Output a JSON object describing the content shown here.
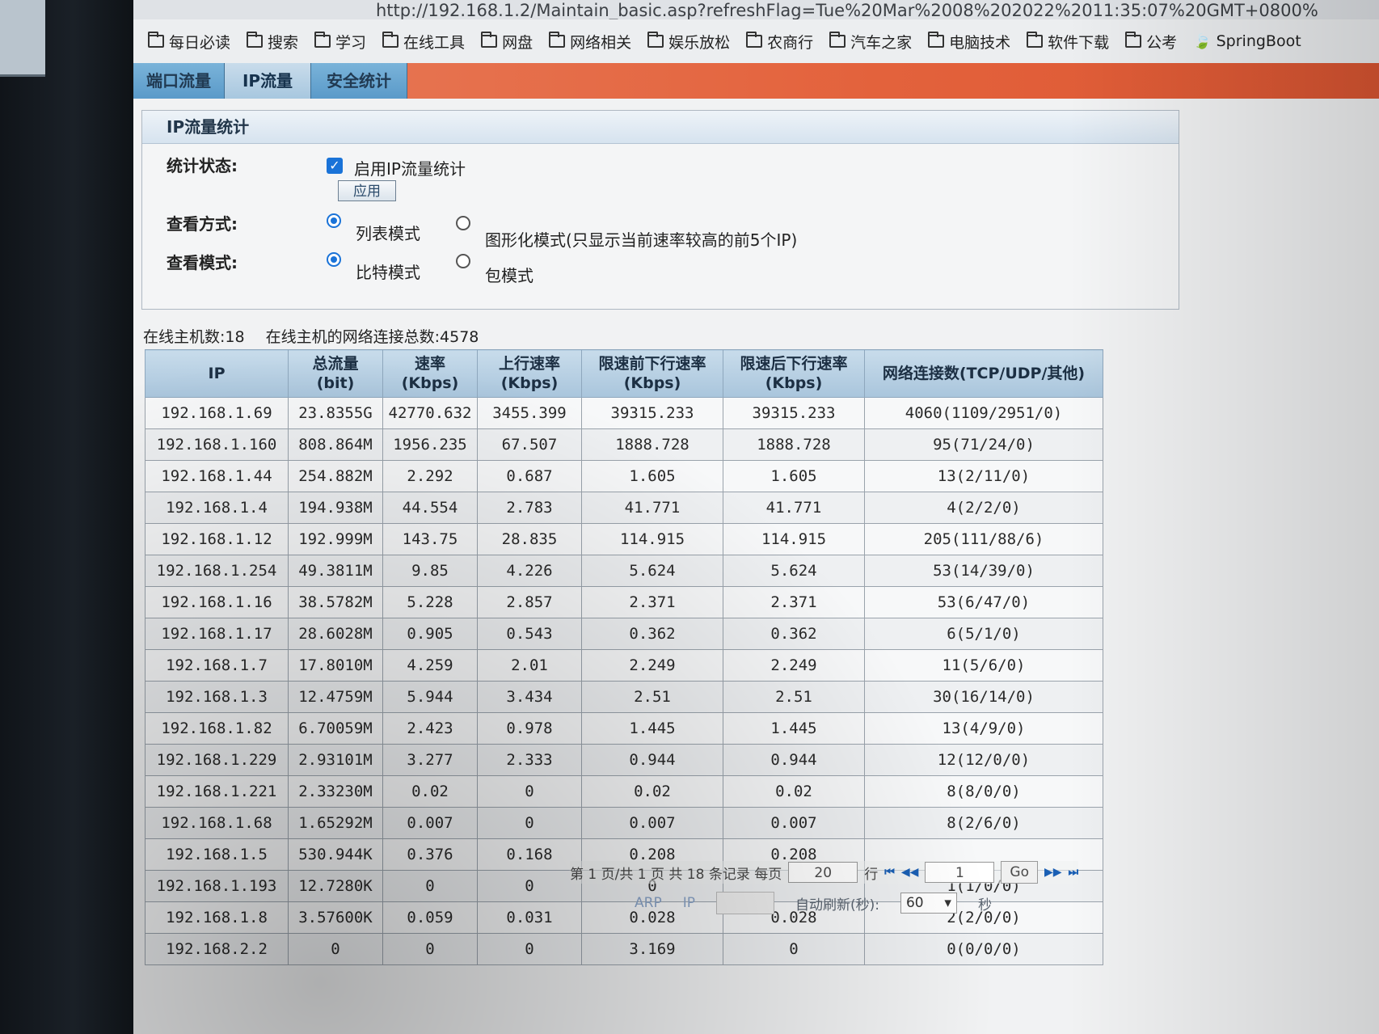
{
  "browser": {
    "url": "http://192.168.1.2/Maintain_basic.asp?refreshFlag=Tue%20Mar%2008%202022%2011:35:07%20GMT+0800%",
    "bookmarks": [
      "每日必读",
      "搜索",
      "学习",
      "在线工具",
      "网盘",
      "网络相关",
      "娱乐放松",
      "农商行",
      "汽车之家",
      "电脑技术",
      "软件下载",
      "公考",
      "SpringBoot"
    ]
  },
  "tabs": [
    {
      "label": "端口流量",
      "active": false
    },
    {
      "label": "IP流量",
      "active": true
    },
    {
      "label": "安全统计",
      "active": false
    }
  ],
  "panel": {
    "title": "IP流量统计",
    "status_label": "统计状态:",
    "enable_label": "启用IP流量统计",
    "enable_checked": true,
    "apply_label": "应用",
    "view_method_label": "查看方式:",
    "view_method_options": [
      "列表模式",
      "图形化模式(只显示当前速率较高的前5个IP)"
    ],
    "view_method_selected": 0,
    "view_mode_label": "查看模式:",
    "view_mode_options": [
      "比特模式",
      "包模式"
    ],
    "view_mode_selected": 0
  },
  "summary": {
    "online_hosts": "在线主机数:18",
    "online_connections": "在线主机的网络连接总数:4578"
  },
  "table": {
    "headers": [
      "IP",
      "总流量\n(bit)",
      "速率\n(Kbps)",
      "上行速率\n(Kbps)",
      "限速前下行速率\n(Kbps)",
      "限速后下行速率\n(Kbps)",
      "网络连接数(TCP/UDP/其他)"
    ],
    "rows": [
      [
        "192.168.1.69",
        "23.8355G",
        "42770.632",
        "3455.399",
        "39315.233",
        "39315.233",
        "4060(1109/2951/0)"
      ],
      [
        "192.168.1.160",
        "808.864M",
        "1956.235",
        "67.507",
        "1888.728",
        "1888.728",
        "95(71/24/0)"
      ],
      [
        "192.168.1.44",
        "254.882M",
        "2.292",
        "0.687",
        "1.605",
        "1.605",
        "13(2/11/0)"
      ],
      [
        "192.168.1.4",
        "194.938M",
        "44.554",
        "2.783",
        "41.771",
        "41.771",
        "4(2/2/0)"
      ],
      [
        "192.168.1.12",
        "192.999M",
        "143.75",
        "28.835",
        "114.915",
        "114.915",
        "205(111/88/6)"
      ],
      [
        "192.168.1.254",
        "49.3811M",
        "9.85",
        "4.226",
        "5.624",
        "5.624",
        "53(14/39/0)"
      ],
      [
        "192.168.1.16",
        "38.5782M",
        "5.228",
        "2.857",
        "2.371",
        "2.371",
        "53(6/47/0)"
      ],
      [
        "192.168.1.17",
        "28.6028M",
        "0.905",
        "0.543",
        "0.362",
        "0.362",
        "6(5/1/0)"
      ],
      [
        "192.168.1.7",
        "17.8010M",
        "4.259",
        "2.01",
        "2.249",
        "2.249",
        "11(5/6/0)"
      ],
      [
        "192.168.1.3",
        "12.4759M",
        "5.944",
        "3.434",
        "2.51",
        "2.51",
        "30(16/14/0)"
      ],
      [
        "192.168.1.82",
        "6.70059M",
        "2.423",
        "0.978",
        "1.445",
        "1.445",
        "13(4/9/0)"
      ],
      [
        "192.168.1.229",
        "2.93101M",
        "3.277",
        "2.333",
        "0.944",
        "0.944",
        "12(12/0/0)"
      ],
      [
        "192.168.1.221",
        "2.33230M",
        "0.02",
        "0",
        "0.02",
        "0.02",
        "8(8/0/0)"
      ],
      [
        "192.168.1.68",
        "1.65292M",
        "0.007",
        "0",
        "0.007",
        "0.007",
        "8(2/6/0)"
      ],
      [
        "192.168.1.5",
        "530.944K",
        "0.376",
        "0.168",
        "0.208",
        "0.208",
        ""
      ],
      [
        "192.168.1.193",
        "12.7280K",
        "0",
        "0",
        "0",
        "",
        "1(1/0/0)"
      ],
      [
        "192.168.1.8",
        "3.57600K",
        "0.059",
        "0.031",
        "0.028",
        "0.028",
        "2(2/0/0)"
      ],
      [
        "192.168.2.2",
        "0",
        "0",
        "0",
        "3.169",
        "0",
        "0(0/0/0)"
      ]
    ]
  },
  "pager": {
    "info": "第 1 页/共 1 页 共 18 条记录 每页",
    "per_page": "20",
    "rows_unit": "行",
    "page_value": "1",
    "go_label": "Go"
  },
  "bottom": {
    "arp_link": "ARP",
    "ip_link": "IP",
    "auto_refresh_label": "自动刷新(秒):",
    "refresh_value": "60",
    "seconds_unit": "秒"
  }
}
